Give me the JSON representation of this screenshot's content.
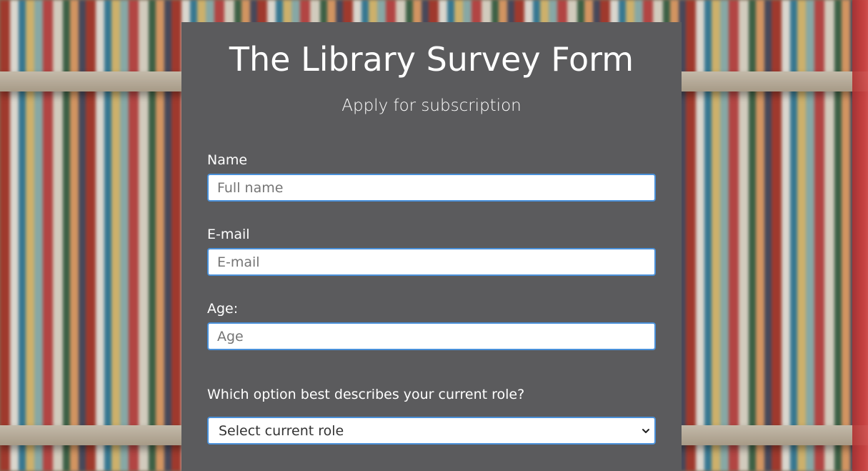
{
  "form": {
    "title": "The Library Survey Form",
    "subtitle": "Apply for subscription",
    "name": {
      "label": "Name",
      "placeholder": "Full name",
      "value": ""
    },
    "email": {
      "label": "E-mail",
      "placeholder": "E-mail",
      "value": ""
    },
    "age": {
      "label": "Age:",
      "placeholder": "Age",
      "value": ""
    },
    "role": {
      "question": "Which option best describes your current role?",
      "selected": "Select current role"
    }
  },
  "colors": {
    "card_background": "#5b5b5d",
    "input_border": "#4a90d9",
    "text": "#ffffff"
  },
  "icons": {
    "select_arrow": "chevron-down-icon"
  }
}
